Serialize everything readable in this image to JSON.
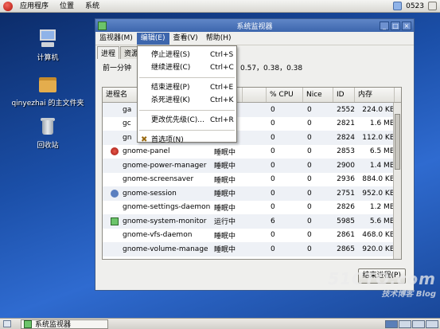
{
  "top_panel": {
    "menus": [
      "应用程序",
      "位置",
      "系统"
    ],
    "clock": "0523"
  },
  "desktop": {
    "icons": [
      {
        "label": "计算机",
        "icon": "computer-icon"
      },
      {
        "label": "qinyezhai 的主文件夹",
        "icon": "home-folder-icon"
      },
      {
        "label": "回收站",
        "icon": "trash-icon"
      }
    ]
  },
  "window": {
    "title": "系统监视器",
    "controls": [
      "_",
      "□",
      "×"
    ],
    "menubar": [
      "监视器(M)",
      "编辑(E)",
      "查看(V)",
      "帮助(H)"
    ],
    "tabs": [
      "进程",
      "资源"
    ],
    "load_label": "前一分钟",
    "load_values": "0.57，0.38，0.38",
    "columns": [
      "进程名",
      "",
      "% CPU",
      "Nice",
      "ID",
      "内存"
    ],
    "rows": [
      {
        "name": "ga",
        "status": "",
        "cpu": "0",
        "nice": "0",
        "id": "2552",
        "mem": "224.0 KB",
        "icon": false
      },
      {
        "name": "gc",
        "status": "",
        "cpu": "0",
        "nice": "0",
        "id": "2821",
        "mem": "1.6 MB",
        "icon": false
      },
      {
        "name": "gn",
        "status": "",
        "cpu": "0",
        "nice": "0",
        "id": "2824",
        "mem": "112.0 KB",
        "icon": false
      },
      {
        "name": "gnome-panel",
        "status": "睡眠中",
        "cpu": "0",
        "nice": "0",
        "id": "2853",
        "mem": "6.5 MB",
        "icon": "panel-icon"
      },
      {
        "name": "gnome-power-manager",
        "status": "睡眠中",
        "cpu": "0",
        "nice": "0",
        "id": "2900",
        "mem": "1.4 MB",
        "icon": false
      },
      {
        "name": "gnome-screensaver",
        "status": "睡眠中",
        "cpu": "0",
        "nice": "0",
        "id": "2936",
        "mem": "884.0 KB",
        "icon": false
      },
      {
        "name": "gnome-session",
        "status": "睡眠中",
        "cpu": "0",
        "nice": "0",
        "id": "2751",
        "mem": "952.0 KB",
        "icon": "session-icon"
      },
      {
        "name": "gnome-settings-daemon",
        "status": "睡眠中",
        "cpu": "0",
        "nice": "0",
        "id": "2826",
        "mem": "1.2 MB",
        "icon": false
      },
      {
        "name": "gnome-system-monitor",
        "status": "运行中",
        "cpu": "6",
        "nice": "0",
        "id": "5985",
        "mem": "5.6 MB",
        "icon": "monitor-icon"
      },
      {
        "name": "gnome-vfs-daemon",
        "status": "睡眠中",
        "cpu": "0",
        "nice": "0",
        "id": "2861",
        "mem": "468.0 KB",
        "icon": false
      },
      {
        "name": "gnome-volume-manage",
        "status": "睡眠中",
        "cpu": "0",
        "nice": "0",
        "id": "2865",
        "mem": "920.0 KB",
        "icon": false
      }
    ],
    "end_button": "结束进程(P)"
  },
  "edit_menu": {
    "items": [
      {
        "label": "停止进程(S)",
        "accel": "Ctrl+S"
      },
      {
        "label": "继续进程(C)",
        "accel": "Ctrl+C"
      },
      {
        "label": "结束进程(P)",
        "accel": "Ctrl+E"
      },
      {
        "label": "杀死进程(K)",
        "accel": "Ctrl+K"
      },
      {
        "label": "更改优先级(C)...",
        "accel": "Ctrl+R"
      },
      {
        "label": "首选项(N)",
        "accel": ""
      }
    ]
  },
  "taskbar": {
    "task_label": "系统监视器"
  },
  "watermark": {
    "line1": "51CTO.com",
    "line2": "技术博客 Blog"
  },
  "colors": {
    "accent": "#3d66ad",
    "desktop": "#1b4fa8"
  }
}
